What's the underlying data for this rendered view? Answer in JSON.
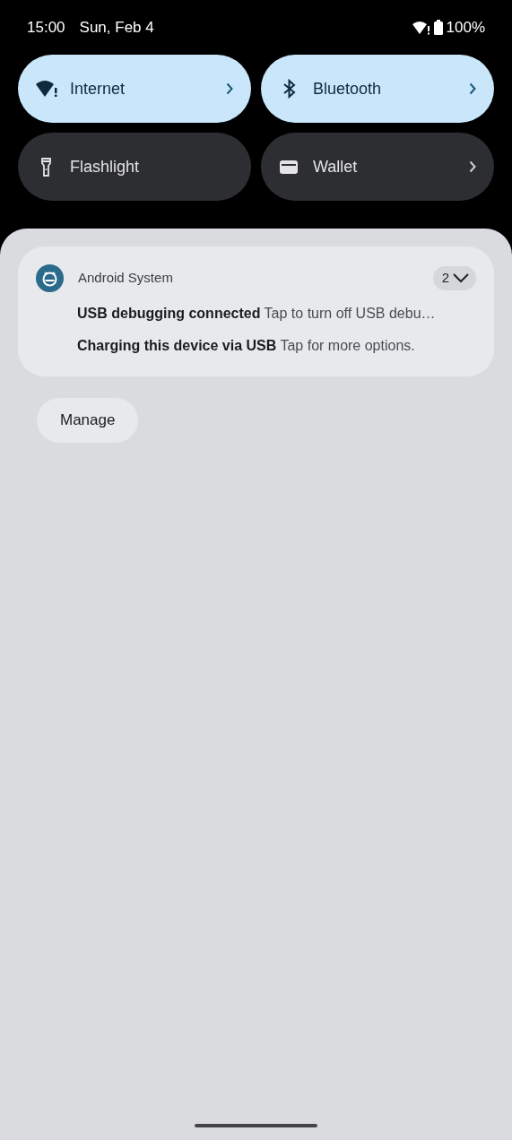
{
  "status_bar": {
    "time": "15:00",
    "date": "Sun, Feb 4",
    "battery": "100%"
  },
  "tiles": [
    {
      "label": "Internet",
      "on": true,
      "has_detail": true
    },
    {
      "label": "Bluetooth",
      "on": true,
      "has_detail": true
    },
    {
      "label": "Flashlight",
      "on": false,
      "has_detail": false
    },
    {
      "label": "Wallet",
      "on": false,
      "has_detail": true
    }
  ],
  "notification": {
    "app": "Android System",
    "count": "2",
    "expanded": false,
    "messages": [
      "**USB debugging connected** Tap to turn off USB debu…",
      "**Charging this device via USB** Tap for more options."
    ]
  },
  "manage_button": "Manage"
}
